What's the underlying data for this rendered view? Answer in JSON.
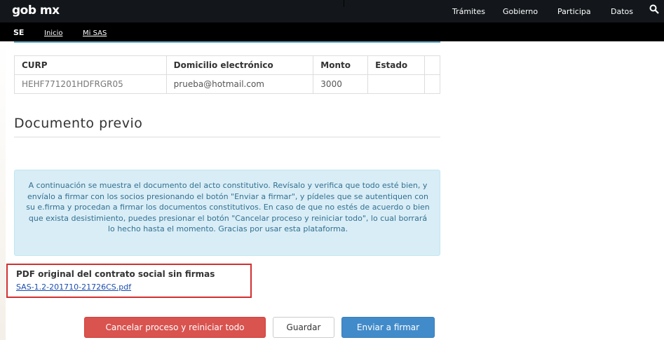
{
  "header": {
    "brand": "gob mx",
    "nav": [
      "Trámites",
      "Gobierno",
      "Participa",
      "Datos"
    ]
  },
  "subnav": {
    "section": "SE",
    "links": [
      "Inicio",
      "Mi SAS"
    ]
  },
  "table": {
    "columns": [
      "CURP",
      "Domicilio electrónico",
      "Monto",
      "Estado",
      ""
    ],
    "rows": [
      [
        "HEHF771201HDFRGR05",
        "prueba@hotmail.com",
        "3000",
        "",
        ""
      ]
    ]
  },
  "section_title": "Documento previo",
  "info_text": "A continuación se muestra el documento del acto constitutivo. Revísalo y verifica que todo esté bien, y envíalo a firmar con los socios presionando el botón \"Enviar a firmar\", y pídeles que se autentiquen con su e.firma y procedan a firmar los documentos constitutivos. En caso de que no estés de acuerdo o bien que exista desistimiento, puedes presionar el botón \"Cancelar proceso y reiniciar todo\", lo cual borrará lo hecho hasta el momento. Gracias por usar esta plataforma.",
  "pdf": {
    "title": "PDF original del contrato social sin firmas",
    "link": "SAS-1.2-201710-21726CS.pdf"
  },
  "buttons": {
    "cancel": "Cancelar proceso y reiniciar todo",
    "save": "Guardar",
    "send": "Enviar a firmar"
  },
  "colors": {
    "header_bg": "#13171b",
    "info_bg": "#d9edf7",
    "info_text": "#31708f",
    "danger": "#d9534f",
    "primary": "#428bca",
    "highlight_border": "#d32f2f"
  }
}
